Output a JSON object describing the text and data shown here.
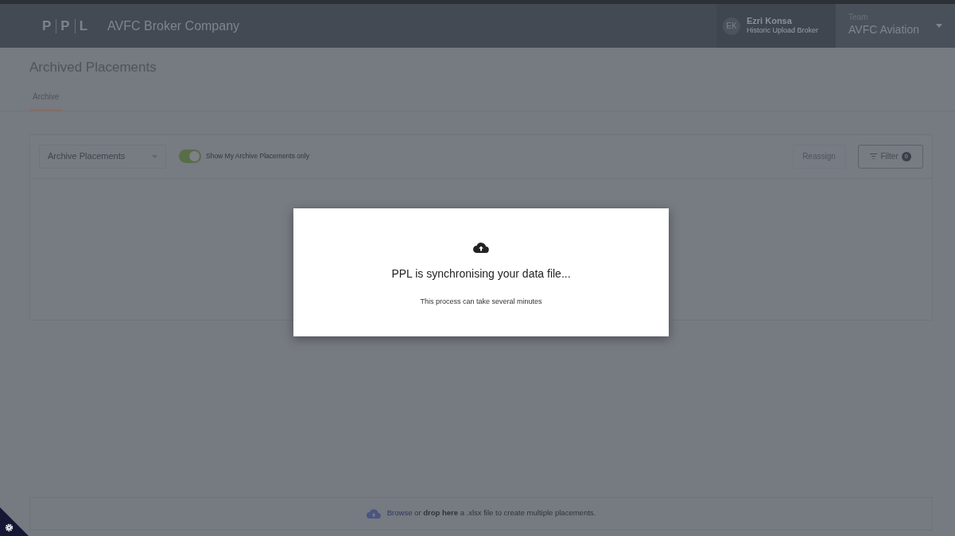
{
  "header": {
    "logo": [
      "P",
      "P",
      "L"
    ],
    "company": "AVFC Broker Company",
    "user": {
      "initials": "EK",
      "name": "Ezri Konsa",
      "role": "Historic Upload Broker"
    },
    "team": {
      "label": "Team",
      "value": "AVFC Aviation"
    }
  },
  "page_title": "Archived Placements",
  "tabs": [
    {
      "label": "Archive",
      "selected": true
    }
  ],
  "toolbar": {
    "select": {
      "value": "Archive Placements"
    },
    "toggle": {
      "label": "Show My Archive Placements only",
      "on": true
    },
    "reassign": {
      "label": "Reassign",
      "disabled": true
    },
    "filter": {
      "label": "Filter",
      "count": "0"
    }
  },
  "upload": {
    "link": "Browse",
    "text": " or **drop here** a .xlsx file to create multiple placements."
  },
  "modal": {
    "title": "PPL is synchronising your data file...",
    "message": "This process can take several minutes"
  }
}
